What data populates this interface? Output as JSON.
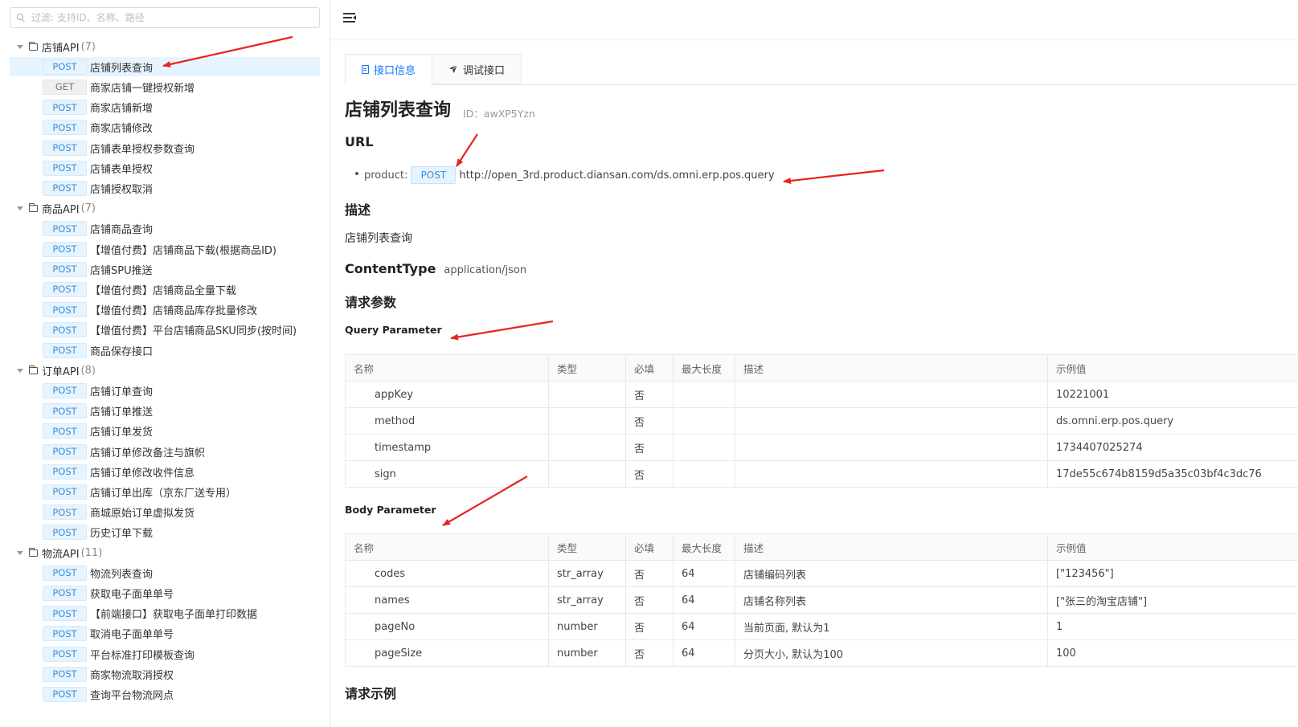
{
  "sidebar": {
    "filter_placeholder": "过滤: 支持ID、名称、路径",
    "groups": [
      {
        "name": "店铺API",
        "count": "(7)",
        "items": [
          {
            "method": "POST",
            "label": "店铺列表查询",
            "selected": true
          },
          {
            "method": "GET",
            "label": "商家店铺一键授权新增"
          },
          {
            "method": "POST",
            "label": "商家店铺新增"
          },
          {
            "method": "POST",
            "label": "商家店铺修改"
          },
          {
            "method": "POST",
            "label": "店铺表单授权参数查询"
          },
          {
            "method": "POST",
            "label": "店铺表单授权"
          },
          {
            "method": "POST",
            "label": "店铺授权取消"
          }
        ]
      },
      {
        "name": "商品API",
        "count": "(7)",
        "items": [
          {
            "method": "POST",
            "label": "店铺商品查询"
          },
          {
            "method": "POST",
            "label": "【增值付费】店铺商品下载(根据商品ID)"
          },
          {
            "method": "POST",
            "label": "店铺SPU推送"
          },
          {
            "method": "POST",
            "label": "【增值付费】店铺商品全量下载"
          },
          {
            "method": "POST",
            "label": "【增值付费】店铺商品库存批量修改"
          },
          {
            "method": "POST",
            "label": "【增值付费】平台店铺商品SKU同步(按时间)"
          },
          {
            "method": "POST",
            "label": "商品保存接口"
          }
        ]
      },
      {
        "name": "订单API",
        "count": "(8)",
        "items": [
          {
            "method": "POST",
            "label": "店铺订单查询"
          },
          {
            "method": "POST",
            "label": "店铺订单推送"
          },
          {
            "method": "POST",
            "label": "店铺订单发货"
          },
          {
            "method": "POST",
            "label": "店铺订单修改备注与旗帜"
          },
          {
            "method": "POST",
            "label": "店铺订单修改收件信息"
          },
          {
            "method": "POST",
            "label": "店铺订单出库（京东厂送专用）"
          },
          {
            "method": "POST",
            "label": "商城原始订单虚拟发货"
          },
          {
            "method": "POST",
            "label": "历史订单下载"
          }
        ]
      },
      {
        "name": "物流API",
        "count": "(11)",
        "items": [
          {
            "method": "POST",
            "label": "物流列表查询"
          },
          {
            "method": "POST",
            "label": "获取电子面单单号"
          },
          {
            "method": "POST",
            "label": "【前端接口】获取电子面单打印数据"
          },
          {
            "method": "POST",
            "label": "取消电子面单单号"
          },
          {
            "method": "POST",
            "label": "平台标准打印模板查询"
          },
          {
            "method": "POST",
            "label": "商家物流取消授权"
          },
          {
            "method": "POST",
            "label": "查询平台物流网点"
          }
        ]
      }
    ]
  },
  "main": {
    "tabs": [
      {
        "label": "接口信息",
        "icon": "document-icon",
        "active": true
      },
      {
        "label": "调试接口",
        "icon": "send-icon",
        "active": false
      }
    ],
    "title": "店铺列表查询",
    "id_label": "ID：awXP5Yzn",
    "url_heading": "URL",
    "url_prefix": "product:",
    "url_method": "POST",
    "url": "http://open_3rd.product.diansan.com/ds.omni.erp.pos.query",
    "desc_heading": "描述",
    "desc_text": "店铺列表查询",
    "content_type_label": "ContentType",
    "content_type_value": "application/json",
    "params_heading": "请求参数",
    "query_heading": "Query Parameter",
    "body_heading": "Body Parameter",
    "example_heading": "请求示例",
    "columns": [
      "名称",
      "类型",
      "必填",
      "最大长度",
      "描述",
      "示例值"
    ],
    "query_params": [
      [
        "appKey",
        "",
        "否",
        "",
        "",
        "10221001"
      ],
      [
        "method",
        "",
        "否",
        "",
        "",
        "ds.omni.erp.pos.query"
      ],
      [
        "timestamp",
        "",
        "否",
        "",
        "",
        "1734407025274"
      ],
      [
        "sign",
        "",
        "否",
        "",
        "",
        "17de55c674b8159d5a35c03bf4c3dc76"
      ]
    ],
    "body_params": [
      [
        "codes",
        "str_array",
        "否",
        "64",
        "店铺编码列表",
        "[\"123456\"]"
      ],
      [
        "names",
        "str_array",
        "否",
        "64",
        "店铺名称列表",
        "[\"张三的淘宝店铺\"]"
      ],
      [
        "pageNo",
        "number",
        "否",
        "64",
        "当前页面, 默认为1",
        "1"
      ],
      [
        "pageSize",
        "number",
        "否",
        "64",
        "分页大小, 默认为100",
        "100"
      ]
    ]
  },
  "colors": {
    "accent": "#1677ff",
    "badge_post_bg": "#e6f4ff",
    "badge_post_text": "#3d8fd6",
    "selected_row_bg": "#e6f4ff",
    "annotation_arrow": "#e8231e"
  }
}
